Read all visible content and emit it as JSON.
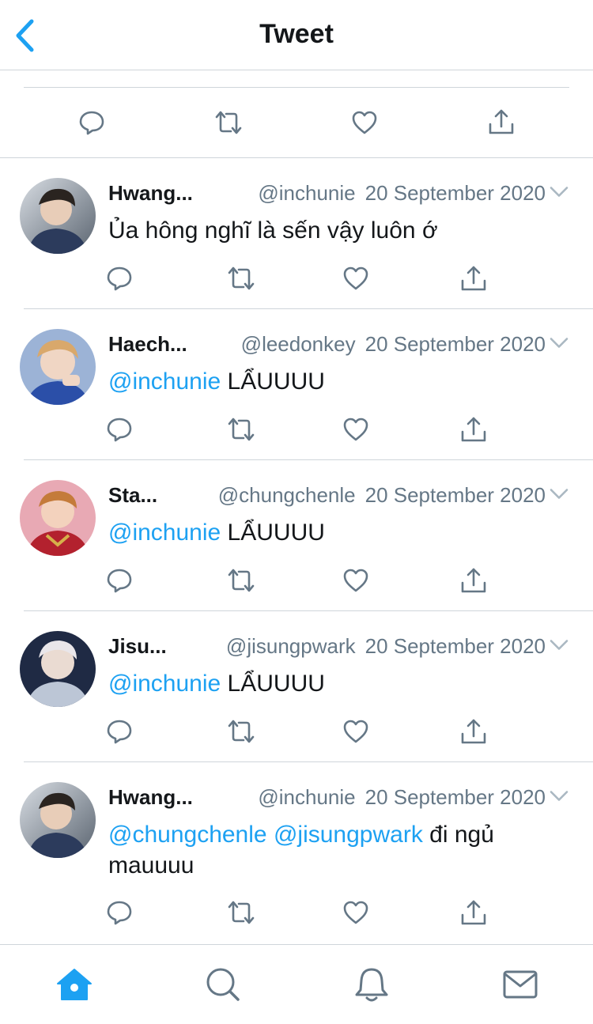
{
  "header": {
    "title": "Tweet"
  },
  "replies": [
    {
      "name": "Hwang...",
      "handle": "@inchunie",
      "date": "20 September 2020",
      "segments": [
        {
          "text": "Ủa hông nghĩ là sến vậy luôn ớ",
          "mention": false
        }
      ]
    },
    {
      "name": "Haech...",
      "handle": "@leedonkey",
      "date": "20 September 2020",
      "segments": [
        {
          "text": "@inchunie",
          "mention": true
        },
        {
          "text": " LẨUUUU",
          "mention": false
        }
      ]
    },
    {
      "name": "Sta...",
      "handle": "@chungchenle",
      "date": "20 September 2020",
      "segments": [
        {
          "text": "@inchunie",
          "mention": true
        },
        {
          "text": " LẨUUUU",
          "mention": false
        }
      ]
    },
    {
      "name": "Jisu...",
      "handle": "@jisungpwark",
      "date": "20 September 2020",
      "segments": [
        {
          "text": "@inchunie",
          "mention": true
        },
        {
          "text": " LẨUUUU",
          "mention": false
        }
      ]
    },
    {
      "name": "Hwang...",
      "handle": "@inchunie",
      "date": "20 September 2020",
      "segments": [
        {
          "text": "@chungchenle",
          "mention": true
        },
        {
          "text": " ",
          "mention": false
        },
        {
          "text": "@jisungpwark",
          "mention": true
        },
        {
          "text": " đi ngủ mauuuu",
          "mention": false
        }
      ]
    }
  ],
  "icons": {
    "back": "chevron-left-icon",
    "reply": "reply-icon",
    "retweet": "retweet-icon",
    "like": "heart-icon",
    "share": "share-icon",
    "more": "chevron-down-icon",
    "tabs": [
      "home-icon",
      "search-icon",
      "notifications-icon",
      "messages-icon"
    ]
  },
  "colors": {
    "accent": "#1da1f2",
    "text": "#14171a",
    "secondary": "#657786",
    "icon": "#657786",
    "divider": "#cfd5da"
  }
}
